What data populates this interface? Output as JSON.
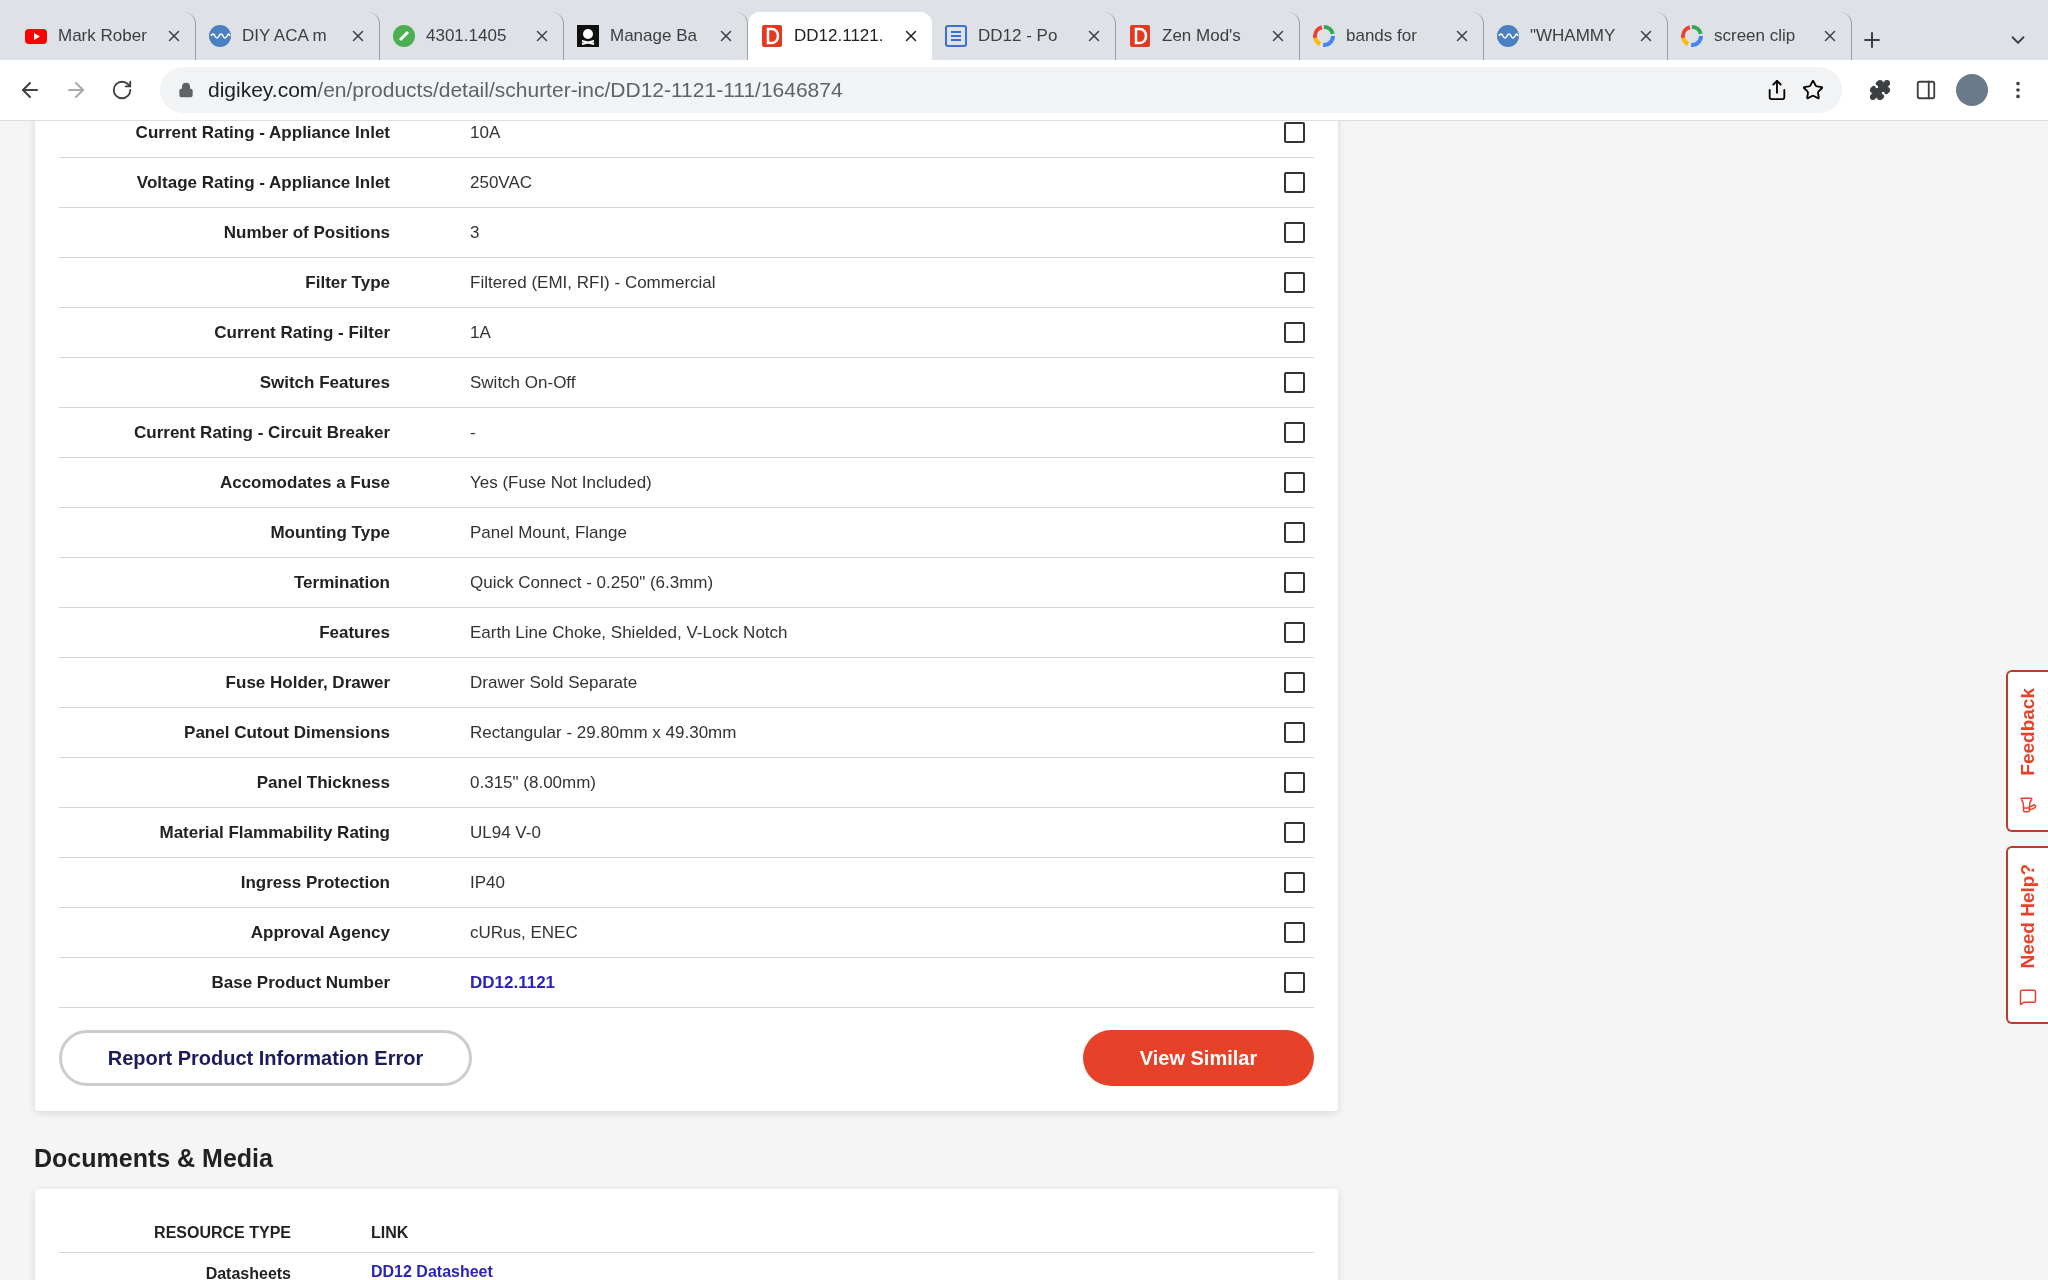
{
  "browser": {
    "tabs": [
      {
        "title": "Mark Rober",
        "kind": "youtube",
        "selected": false
      },
      {
        "title": "DIY ACA m",
        "kind": "wave",
        "selected": false
      },
      {
        "title": "4301.1405",
        "kind": "green",
        "selected": false
      },
      {
        "title": "Manage Ba",
        "kind": "skull",
        "selected": false
      },
      {
        "title": "DD12.1121.",
        "kind": "redd",
        "selected": true
      },
      {
        "title": "DD12 - Po",
        "kind": "doc",
        "selected": false
      },
      {
        "title": "Zen Mod's",
        "kind": "redd",
        "selected": false
      },
      {
        "title": "bands for",
        "kind": "google",
        "selected": false
      },
      {
        "title": "\"WHAMMY",
        "kind": "wave",
        "selected": false
      },
      {
        "title": "screen clip",
        "kind": "google",
        "selected": false
      }
    ],
    "url": {
      "domain": "digikey.com",
      "path": "/en/products/detail/schurter-inc/DD12-1121-111/1646874"
    }
  },
  "attributes": [
    {
      "label": "Current Rating - Appliance Inlet",
      "value": "10A",
      "kind": "text",
      "checked": false
    },
    {
      "label": "Voltage Rating - Appliance Inlet",
      "value": "250VAC",
      "kind": "text",
      "checked": false
    },
    {
      "label": "Number of Positions",
      "value": "3",
      "kind": "text",
      "checked": false
    },
    {
      "label": "Filter Type",
      "value": "Filtered (EMI, RFI) - Commercial",
      "kind": "text",
      "checked": false
    },
    {
      "label": "Current Rating - Filter",
      "value": "1A",
      "kind": "text",
      "checked": false
    },
    {
      "label": "Switch Features",
      "value": "Switch On-Off",
      "kind": "text",
      "checked": false
    },
    {
      "label": "Current Rating - Circuit Breaker",
      "value": "-",
      "kind": "text",
      "checked": false
    },
    {
      "label": "Accomodates a Fuse",
      "value": "Yes (Fuse Not Included)",
      "kind": "text",
      "checked": false
    },
    {
      "label": "Mounting Type",
      "value": "Panel Mount, Flange",
      "kind": "text",
      "checked": false
    },
    {
      "label": "Termination",
      "value": "Quick Connect - 0.250\" (6.3mm)",
      "kind": "text",
      "checked": false
    },
    {
      "label": "Features",
      "value": "Earth Line Choke, Shielded, V-Lock Notch",
      "kind": "text",
      "checked": false
    },
    {
      "label": "Fuse Holder, Drawer",
      "value": "Drawer Sold Separate",
      "kind": "text",
      "checked": false
    },
    {
      "label": "Panel Cutout Dimensions",
      "value": "Rectangular - 29.80mm x 49.30mm",
      "kind": "text",
      "checked": false
    },
    {
      "label": "Panel Thickness",
      "value": "0.315\" (8.00mm)",
      "kind": "text",
      "checked": false
    },
    {
      "label": "Material Flammability Rating",
      "value": "UL94 V-0",
      "kind": "text",
      "checked": false
    },
    {
      "label": "Ingress Protection",
      "value": "IP40",
      "kind": "text",
      "checked": false
    },
    {
      "label": "Approval Agency",
      "value": "cURus, ENEC",
      "kind": "text",
      "checked": false
    },
    {
      "label": "Base Product Number",
      "value": "DD12.1121",
      "kind": "link",
      "checked": false
    }
  ],
  "actions": {
    "report": "Report Product Information Error",
    "similar": "View Similar"
  },
  "documents": {
    "heading": "Documents & Media",
    "columns": [
      "RESOURCE TYPE",
      "LINK"
    ],
    "rows": [
      {
        "type": "Datasheets",
        "link": "DD12 Datasheet"
      }
    ]
  },
  "side_tabs": [
    {
      "label": "Feedback",
      "kind": "feedback"
    },
    {
      "label": "Need Help?",
      "kind": "help"
    }
  ]
}
